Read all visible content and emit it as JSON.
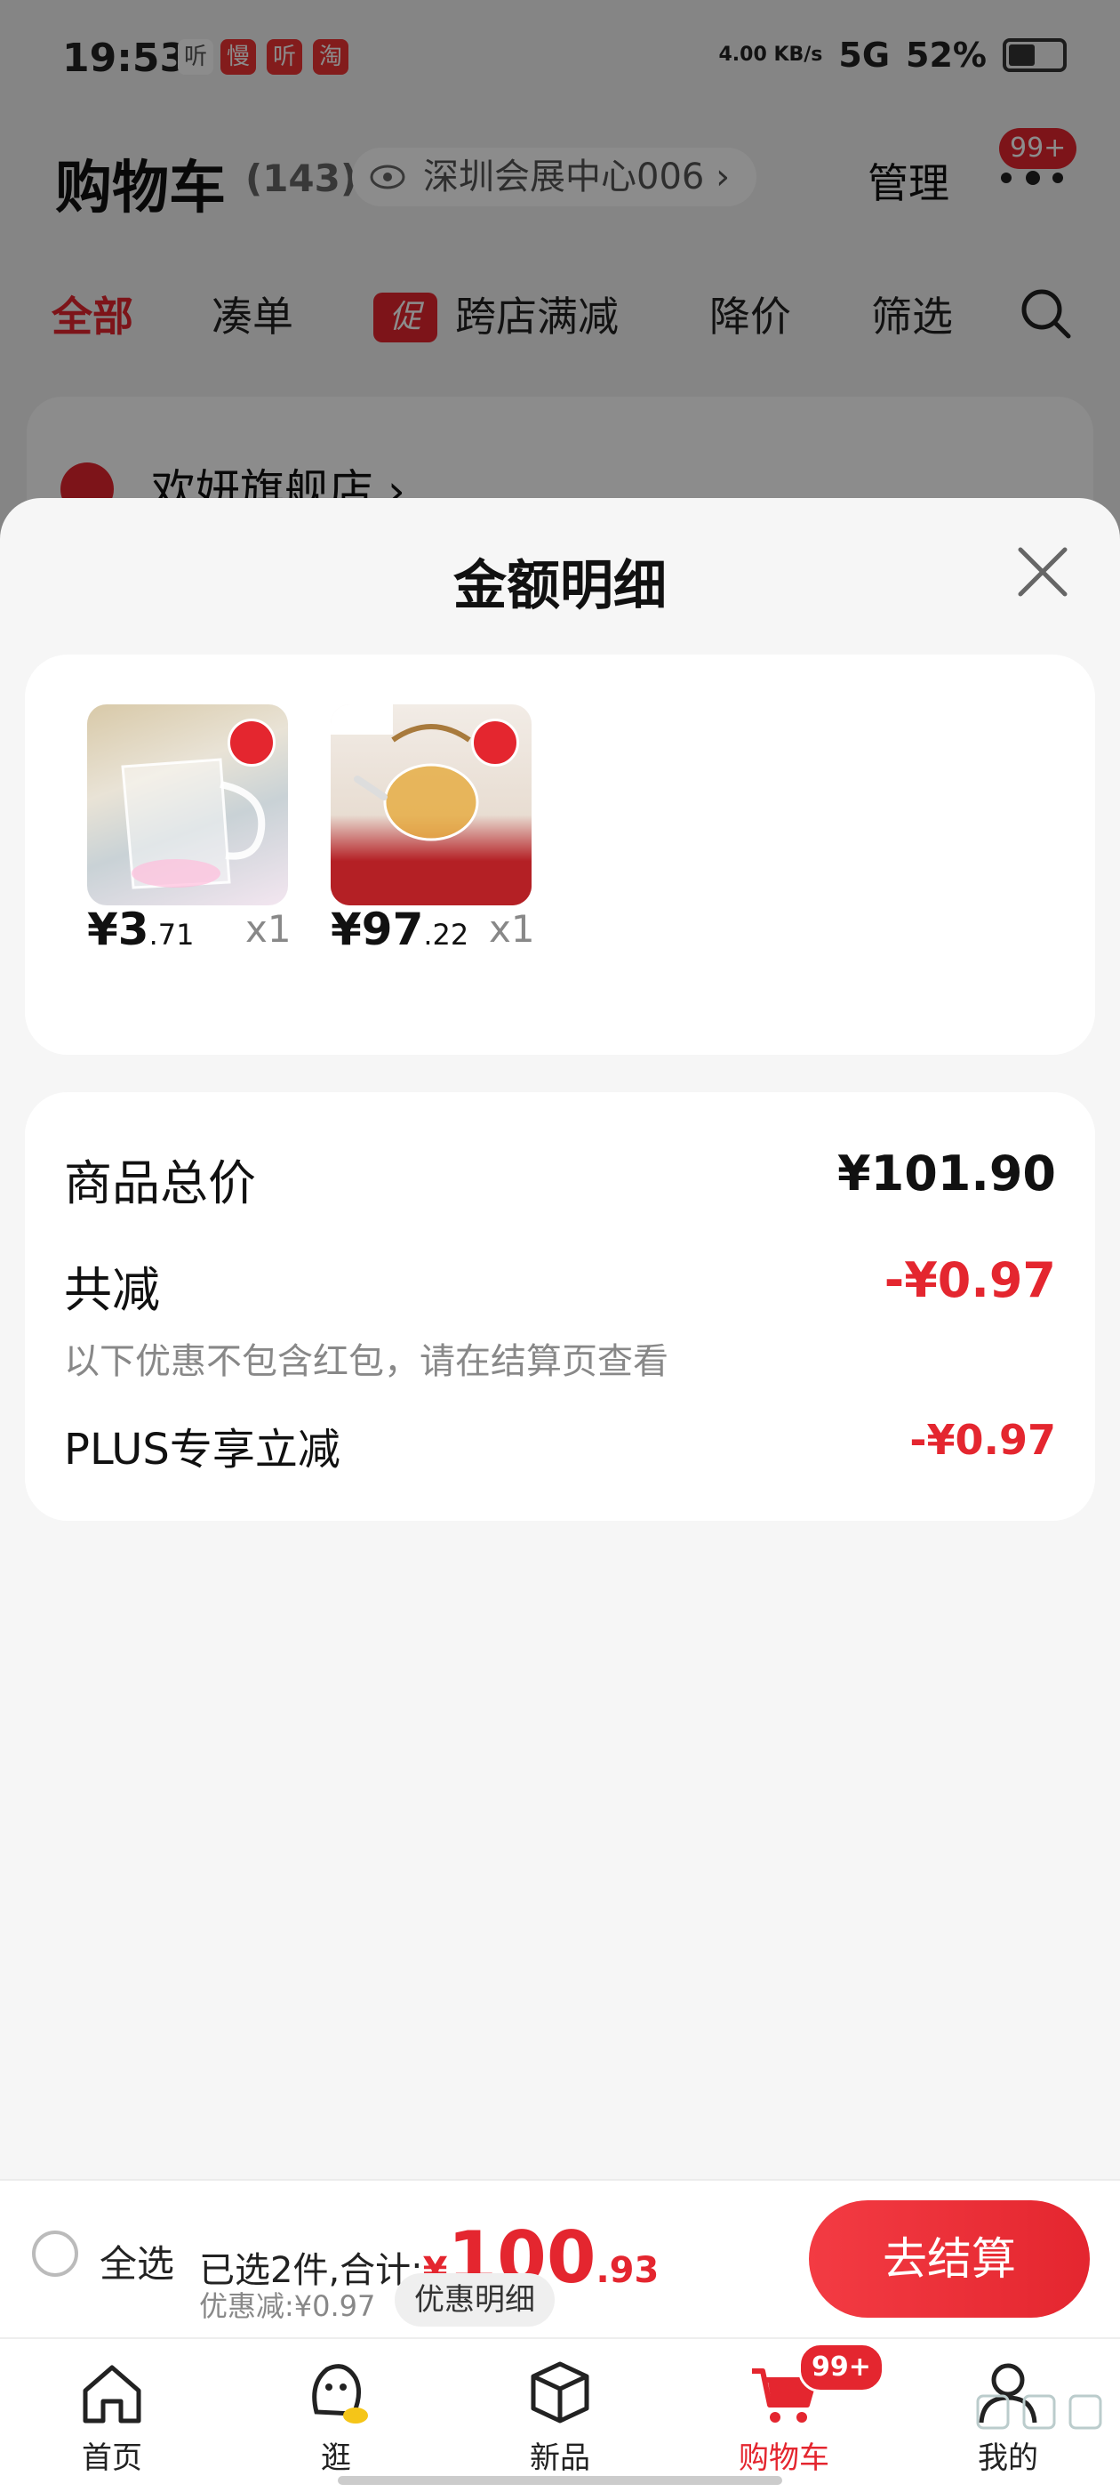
{
  "status_bar": {
    "time": "19:53",
    "app_icons": [
      "听",
      "慢",
      "听",
      "淘"
    ],
    "network_speed": "4.00 KB/s",
    "signal": "5G",
    "battery": "52%"
  },
  "header": {
    "title": "购物车",
    "count": "(143)",
    "location": "深圳会展中心006",
    "manage_label": "管理",
    "message_badge": "99+"
  },
  "filter_tabs": [
    {
      "label": "全部",
      "active": true
    },
    {
      "label": "凑单"
    },
    {
      "label": "跨店满减",
      "tag": "促"
    },
    {
      "label": "降价"
    },
    {
      "label": "筛选"
    }
  ],
  "store": {
    "name": "欢妍旗舰店 ›"
  },
  "sheet": {
    "title": "金额明细",
    "items": [
      {
        "price_main": "¥3",
        "price_dec": ".71",
        "qty": "x1",
        "image": "glass-cup"
      },
      {
        "price_main": "¥97",
        "price_dec": ".22",
        "qty": "x1",
        "image": "glass-teapot"
      }
    ],
    "total_label": "商品总价",
    "total_value": "¥101.90",
    "discount_label": "共减",
    "discount_value": "-¥0.97",
    "discount_note": "以下优惠不包含红包，请在结算页查看",
    "plus_label": "PLUS专享立减",
    "plus_value": "-¥0.97"
  },
  "checkout": {
    "select_all_label": "全选",
    "selected_text": "已选2件,合计:",
    "currency": "¥",
    "total_int": "100",
    "total_dec": ".93",
    "discount_text": "优惠减:¥0.97",
    "detail_label": "优惠明细",
    "checkout_label": "去结算"
  },
  "tab_bar": {
    "items": [
      {
        "label": "首页",
        "icon": "home-icon"
      },
      {
        "label": "逛",
        "icon": "browse-icon"
      },
      {
        "label": "新品",
        "icon": "box-icon"
      },
      {
        "label": "购物车",
        "icon": "cart-icon",
        "active": true
      },
      {
        "label": "我的",
        "icon": "profile-icon"
      }
    ],
    "cart_badge": "99+"
  },
  "colors": {
    "accent": "#e4262f",
    "background": "#f6f6f6"
  }
}
